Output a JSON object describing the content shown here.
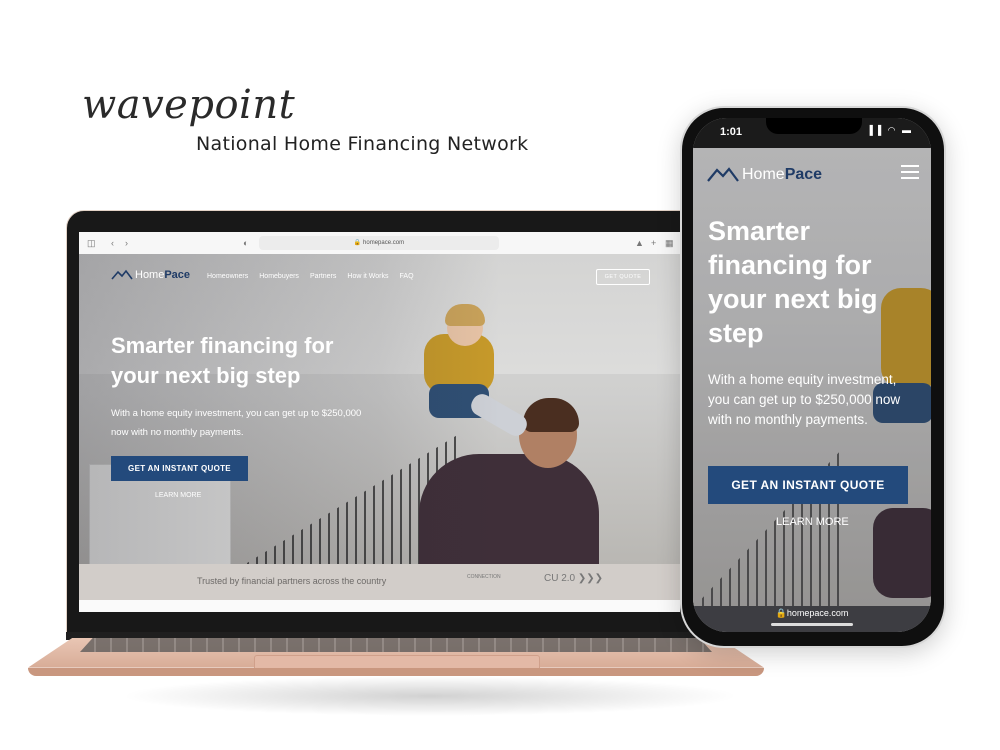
{
  "branding": {
    "logo": "wavepoint",
    "tagline": "National Home Financing Network"
  },
  "laptop": {
    "url": "homepace.com",
    "site": {
      "logo_part1": "Home",
      "logo_part2": "Pace",
      "nav": [
        "Homeowners",
        "Homebuyers",
        "Partners",
        "How it Works",
        "FAQ"
      ],
      "quote_button": "GET QUOTE",
      "headline": "Smarter financing for your next big step",
      "subtext": "With a home equity investment, you can get up to $250,000 now with no monthly payments.",
      "cta": "GET AN INSTANT QUOTE",
      "learn_more": "LEARN MORE",
      "trust_text": "Trusted by financial partners across the country",
      "partner1": "CONNECTION",
      "partner2": "CU 2.0 ❯❯❯"
    }
  },
  "phone": {
    "time": "1:01",
    "status_icons": "▐▐ ◠ ▬",
    "url": "homepace.com",
    "site": {
      "logo_part1": "Home",
      "logo_part2": "Pace",
      "headline": "Smarter financing for your next big step",
      "subtext": "With a home equity investment, you can get up to $250,000 now with no monthly payments.",
      "cta": "GET AN INSTANT QUOTE",
      "learn_more": "LEARN MORE"
    }
  },
  "colors": {
    "brand_navy": "#234a7c",
    "laptop_rose_gold": "#e9c6b4",
    "trust_bar": "#d2cdc9"
  },
  "icons": [
    "roof-logo-icon",
    "hamburger-menu-icon",
    "sidebar-icon",
    "back-arrow-icon",
    "forward-arrow-icon",
    "share-icon",
    "new-tab-icon",
    "tabs-icon",
    "lock-icon"
  ]
}
